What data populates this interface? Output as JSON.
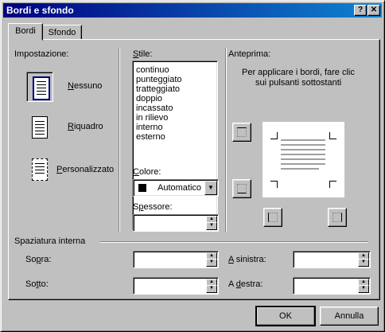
{
  "window": {
    "title": "Bordi e sfondo",
    "help_button": "?",
    "close_button": "✕"
  },
  "tabs": [
    {
      "label": "Bordi"
    },
    {
      "label": "Sfondo"
    }
  ],
  "setting": {
    "heading": "Impostazione:",
    "options": [
      {
        "label": "Nessuno",
        "key": "N",
        "rest": "essuno"
      },
      {
        "label": "Riquadro",
        "key": "R",
        "rest": "iquadro"
      },
      {
        "label": "Personalizzato",
        "key": "P",
        "rest": "ersonalizzato"
      }
    ]
  },
  "style": {
    "label_key": "S",
    "label_rest": "tile:",
    "items": [
      "continuo",
      "punteggiato",
      "tratteggiato",
      "doppio",
      "incassato",
      "in rilievo",
      "interno",
      "esterno"
    ]
  },
  "color": {
    "label_key": "C",
    "label_rest": "olore:",
    "value": "Automatico",
    "swatch": "#000000"
  },
  "thickness": {
    "label_key": "p",
    "label_pre": "S",
    "label_rest": "essore:",
    "value": ""
  },
  "preview": {
    "heading": "Anteprima:",
    "hint_line1": "Per applicare i bordi, fare clic",
    "hint_line2": "sui pulsanti sottostanti"
  },
  "padding": {
    "heading": "Spaziatura interna",
    "top": {
      "label_key": "p",
      "label_pre": "So",
      "label_rest": "ra:",
      "value": ""
    },
    "bottom": {
      "label_key": "t",
      "label_pre": "So",
      "label_rest": "to:",
      "value": ""
    },
    "left": {
      "label_key": "A",
      "label_pre": "",
      "label_rest": " sinistra:",
      "value": ""
    },
    "right": {
      "label_key": "d",
      "label_pre": "A ",
      "label_rest": "estra:",
      "value": ""
    }
  },
  "buttons": {
    "ok": "OK",
    "cancel": "Annulla"
  }
}
